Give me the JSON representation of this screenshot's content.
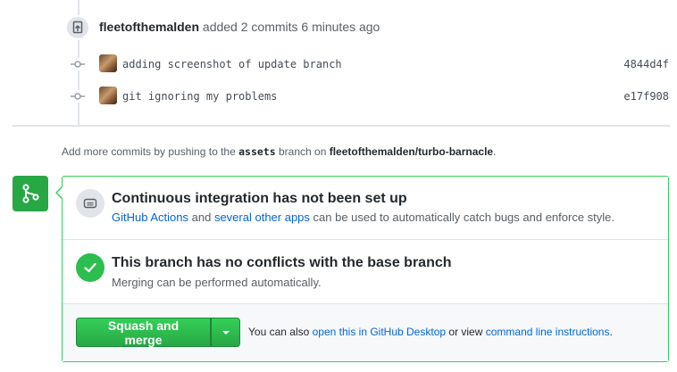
{
  "timeline": {
    "author": "fleetofthemalden",
    "event_text": "added 2 commits 6 minutes ago",
    "event_icon": "repo-push-icon",
    "commits": [
      {
        "message": "adding screenshot of update branch",
        "sha": "4844d4f"
      },
      {
        "message": "git ignoring my problems",
        "sha": "e17f908"
      }
    ]
  },
  "push_hint": {
    "prefix": "Add more commits by pushing to the",
    "branch": "assets",
    "middle": "branch on",
    "repo": "fleetofthemalden/turbo-barnacle",
    "suffix": "."
  },
  "merge_panel": {
    "icon": "git-merge-icon",
    "ci": {
      "title": "Continuous integration has not been set up",
      "link1": "GitHub Actions",
      "and": "and",
      "link2": "several other apps",
      "rest": "can be used to automatically catch bugs and enforce style."
    },
    "conflicts": {
      "title": "This branch has no conflicts with the base branch",
      "subtitle": "Merging can be performed automatically."
    },
    "actions": {
      "button_label": "Squash and merge",
      "prefix": "You can also",
      "link_desktop": "open this in GitHub Desktop",
      "or_view": "or view",
      "link_cli": "command line instructions",
      "suffix": "."
    }
  },
  "colors": {
    "accent_green": "#28a745",
    "link_blue": "#0366d6",
    "border_green": "#34d058"
  }
}
